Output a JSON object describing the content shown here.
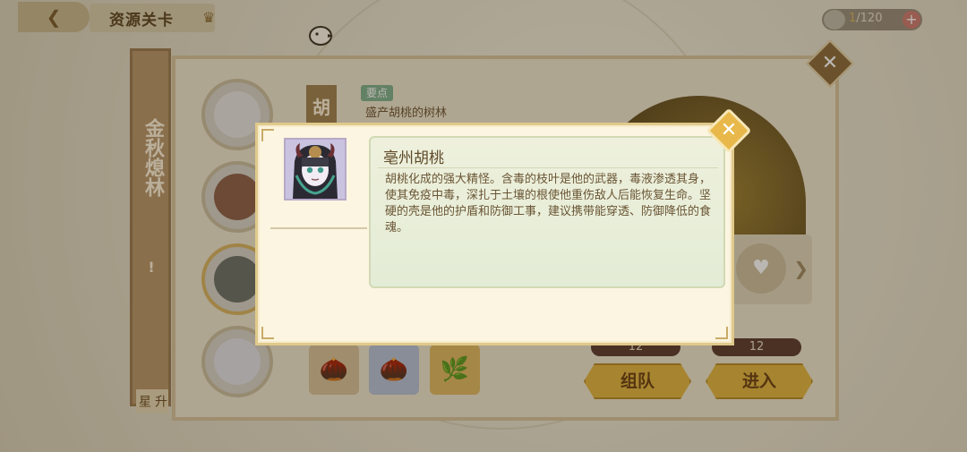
{
  "header": {
    "back_icon": "back-arrow-icon",
    "title": "资源关卡",
    "crown_icon": "crown-icon",
    "stamina": {
      "current": "1",
      "max": "/120",
      "plus_label": "+"
    }
  },
  "side_tab": {
    "name": "金秋熄林",
    "warning": "!",
    "upgrade_label": "升星"
  },
  "stage": {
    "tab_label": "胡",
    "keypoint_label": "要点",
    "keypoint_text": "盛产胡桃的树林",
    "counts": [
      "12",
      "12"
    ],
    "team_button": "组队",
    "enter_button": "进入"
  },
  "modal": {
    "title": "亳州胡桃",
    "description": "胡桃化成的强大精怪。含毒的枝叶是他的武器，毒液渗透其身，使其免疫中毒，深扎于土壤的根使他重伤敌人后能恢复生命。坚硬的壳是他的护盾和防御工事，建议携带能穿透、防御降低的食魂。",
    "close_label": "✕"
  },
  "colors": {
    "accent_gold": "#e3b540",
    "panel_bg": "#fbf5e1",
    "info_bg": "#e3ecd6",
    "tab_brown": "#b8966a"
  }
}
